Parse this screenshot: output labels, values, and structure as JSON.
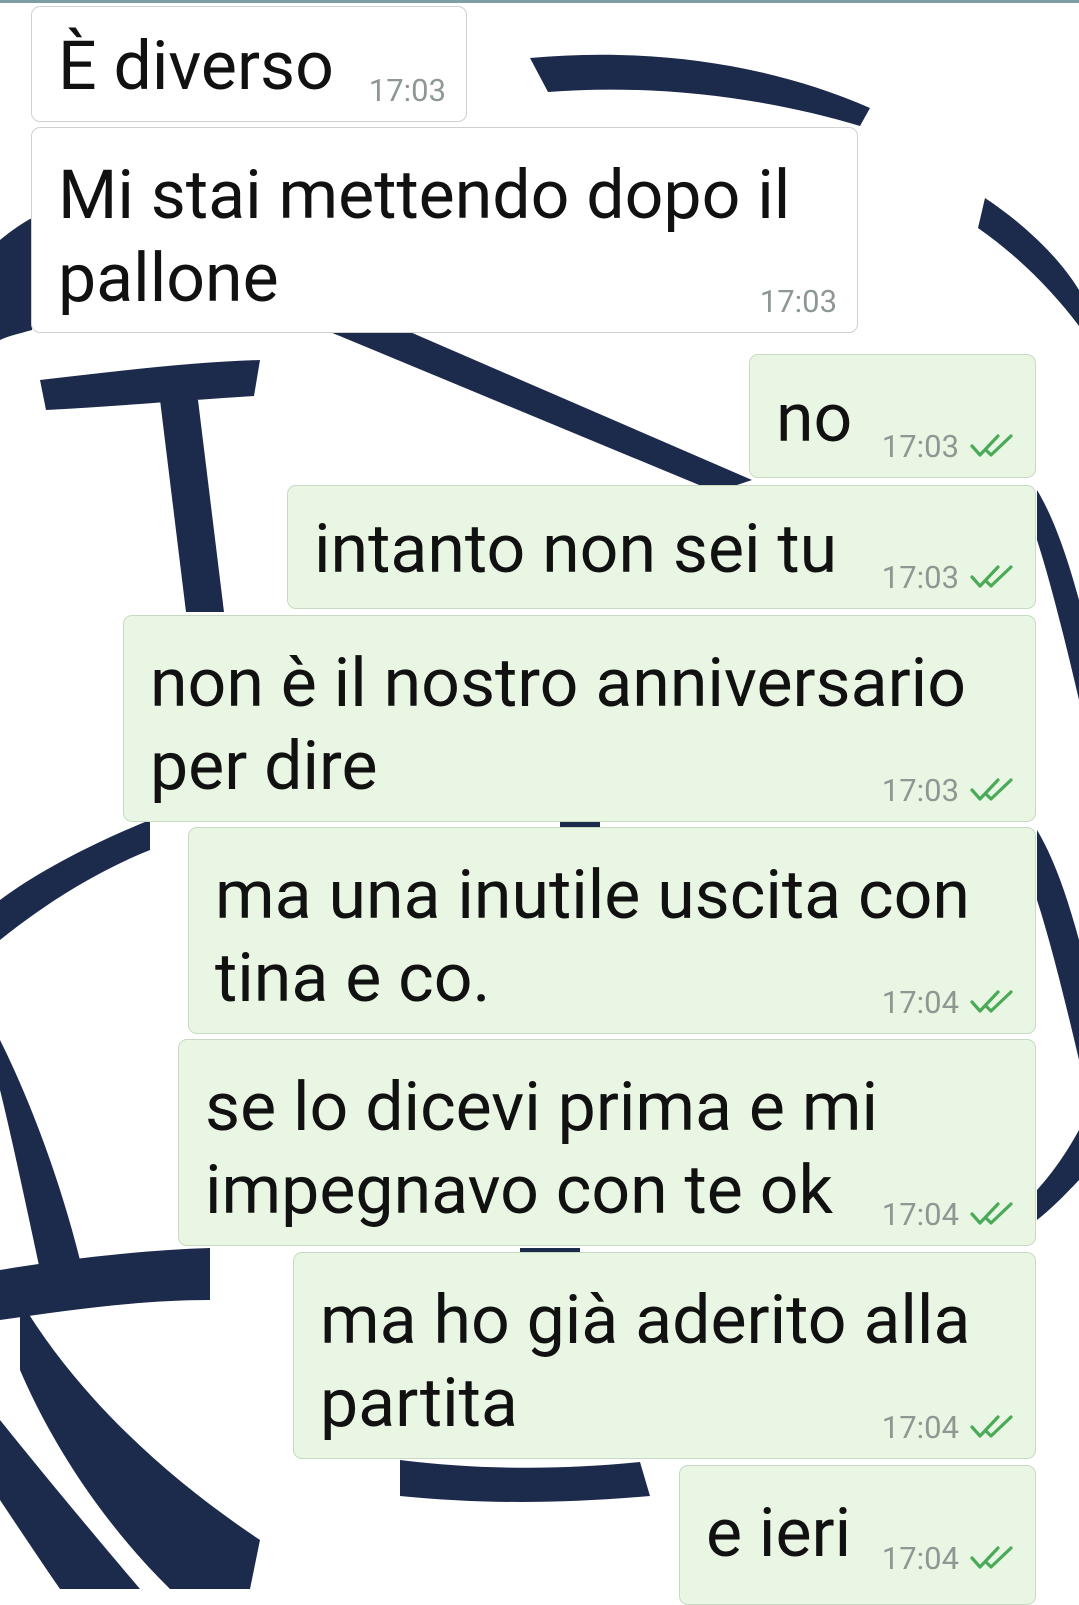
{
  "wallpaper": {
    "shape_color": "#1c2a4c",
    "background_color": "#ffffff"
  },
  "colors": {
    "incoming_bubble": "#ffffff",
    "outgoing_bubble": "#e9f6e3",
    "timestamp": "#8e9893",
    "read_tick": "#4aaa57"
  },
  "messages": [
    {
      "direction": "incoming",
      "text": "È diverso",
      "time": "17:03"
    },
    {
      "direction": "incoming",
      "text_line1": "Mi stai mettendo dopo il",
      "text_line2": "pallone",
      "time": "17:03"
    },
    {
      "direction": "outgoing",
      "text": "no",
      "time": "17:03",
      "status_icon": "double-check-icon"
    },
    {
      "direction": "outgoing",
      "text": "intanto non sei tu",
      "time": "17:03",
      "status_icon": "double-check-icon"
    },
    {
      "direction": "outgoing",
      "text_line1": "non è il nostro anniversario",
      "text_line2": "per dire",
      "time": "17:03",
      "status_icon": "double-check-icon"
    },
    {
      "direction": "outgoing",
      "text_line1": "ma una inutile uscita con",
      "text_line2": "tina e co.",
      "time": "17:04",
      "status_icon": "double-check-icon"
    },
    {
      "direction": "outgoing",
      "text_line1": "se lo dicevi prima e mi",
      "text_line2": "impegnavo con te ok",
      "time": "17:04",
      "status_icon": "double-check-icon"
    },
    {
      "direction": "outgoing",
      "text_line1": "ma ho già aderito alla",
      "text_line2": "partita",
      "time": "17:04",
      "status_icon": "double-check-icon"
    },
    {
      "direction": "outgoing",
      "text": "e ieri",
      "time": "17:04",
      "status_icon": "double-check-icon"
    }
  ]
}
